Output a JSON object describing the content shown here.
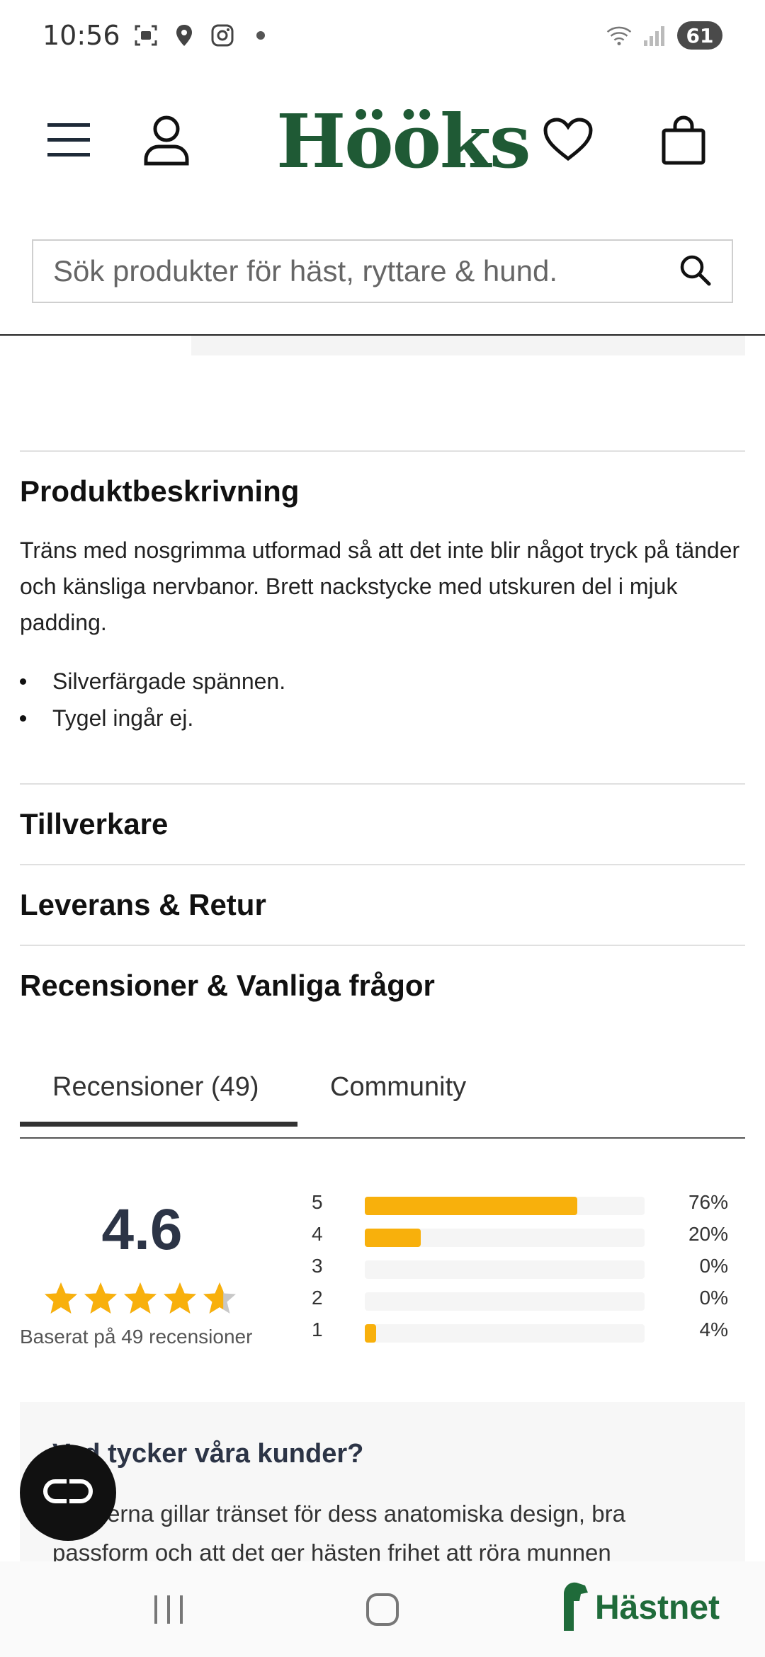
{
  "status_bar": {
    "time": "10:56",
    "battery": "61"
  },
  "header": {
    "logo": "Hööks"
  },
  "search": {
    "placeholder": "Sök produkter för häst, ryttare & hund."
  },
  "description": {
    "title": "Produktbeskrivning",
    "text": "Träns med nosgrimma utformad så att det inte blir något tryck på tänder och känsliga nervbanor. Brett nackstycke med utskuren del i mjuk padding.",
    "bullets": [
      "Silverfärgade spännen.",
      "Tygel ingår ej."
    ]
  },
  "sections": {
    "manufacturer": "Tillverkare",
    "shipping": "Leverans & Retur",
    "reviews_faq": "Recensioner & Vanliga frågor"
  },
  "tabs": {
    "reviews": "Recensioner (49)",
    "community": "Community"
  },
  "rating": {
    "average": "4.6",
    "stars_value": 4.6,
    "basis": "Baserat på 49 recensioner",
    "distribution": [
      {
        "stars": "5",
        "percent": "76%",
        "value": 76
      },
      {
        "stars": "4",
        "percent": "20%",
        "value": 20
      },
      {
        "stars": "3",
        "percent": "0%",
        "value": 0
      },
      {
        "stars": "2",
        "percent": "0%",
        "value": 0
      },
      {
        "stars": "1",
        "percent": "4%",
        "value": 4
      }
    ]
  },
  "summary_card": {
    "title": "Vad tycker våra kunder?",
    "text": "Kunderna gillar tränset för dess anatomiska design, bra passform och att det ger hästen frihet att röra munnen"
  },
  "navbar": {
    "brand": "Hästnet"
  },
  "colors": {
    "brand_green": "#1f5a35",
    "star_gold": "#f8b00c",
    "dark_text": "#2c3446"
  }
}
